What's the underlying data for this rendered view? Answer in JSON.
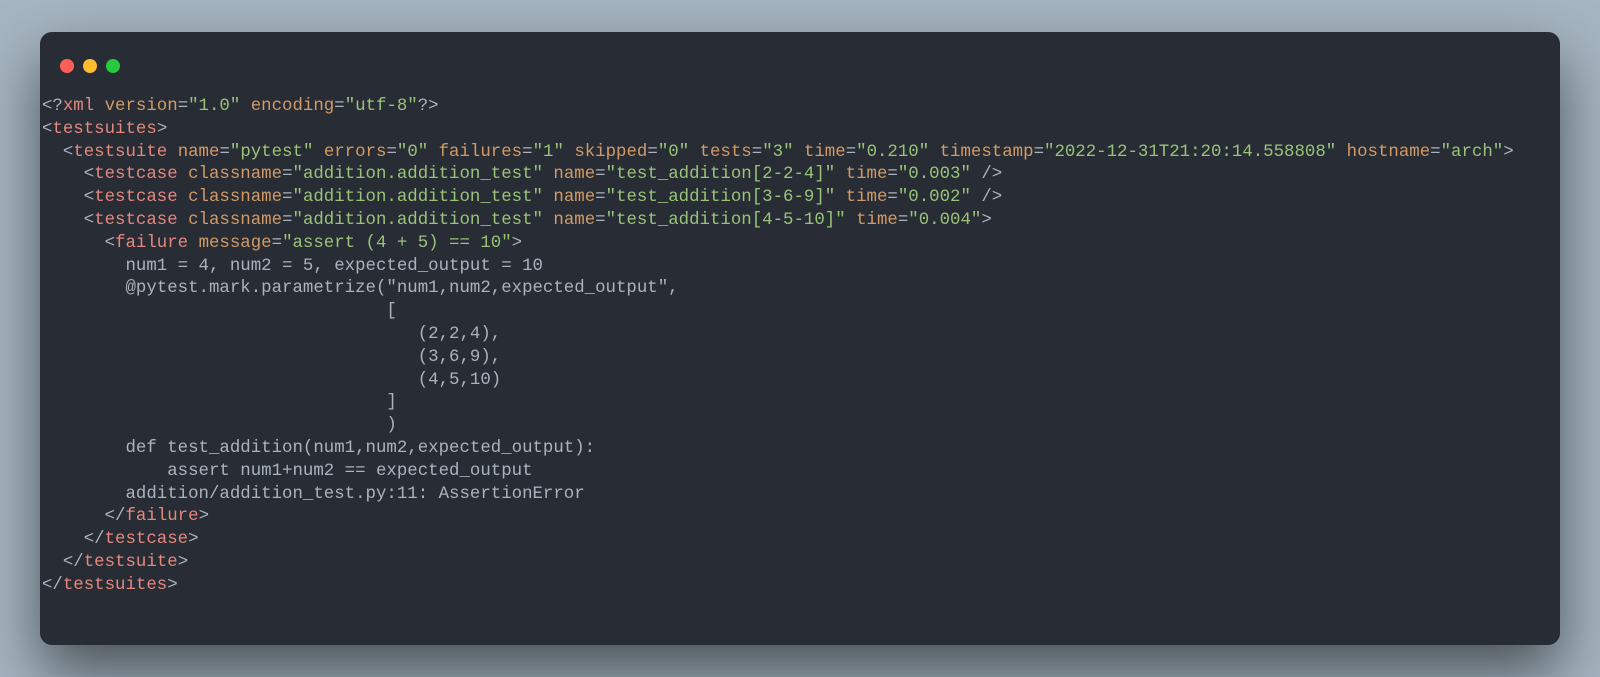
{
  "line1": "<?xml version=\"1.0\" encoding=\"utf-8\"?>",
  "line2_tag": "testsuites",
  "line3": {
    "tag": "testsuite",
    "attrs": {
      "name": "pytest",
      "errors": "0",
      "failures": "1",
      "skipped": "0",
      "tests": "3",
      "time": "0.210",
      "timestamp": "2022-12-31T21:20:14.558808",
      "hostname": "arch"
    }
  },
  "case1": {
    "tag": "testcase",
    "classname": "addition.addition_test",
    "name": "test_addition[2-2-4]",
    "time": "0.003"
  },
  "case2": {
    "tag": "testcase",
    "classname": "addition.addition_test",
    "name": "test_addition[3-6-9]",
    "time": "0.002"
  },
  "case3": {
    "tag": "testcase",
    "classname": "addition.addition_test",
    "name": "test_addition[4-5-10]",
    "time": "0.004"
  },
  "failure": {
    "tag": "failure",
    "message": "assert (4 + 5) == 10"
  },
  "body": {
    "l1": "      num1 = 4, num2 = 5, expected_output = 10",
    "l2": "      @pytest.mark.parametrize(\"num1,num2,expected_output\",",
    "l3": "                               [",
    "l4": "                                  (2,2,4),",
    "l5": "                                  (3,6,9),",
    "l6": "                                  (4,5,10)",
    "l7": "                               ]",
    "l8": "                               )",
    "l9": "      def test_addition(num1,num2,expected_output):",
    "l10": "          assert num1+num2 == expected_output",
    "l11": "      addition/addition_test.py:11: AssertionError"
  },
  "close_failure": "failure",
  "close_testcase": "testcase",
  "close_testsuite": "testsuite",
  "close_testsuites": "testsuites",
  "literals": {
    "xml": "xml",
    "version": "version",
    "encoding": "encoding",
    "v10": "\"1.0\"",
    "utf8": "\"utf-8\"",
    "name": "name",
    "errors": "errors",
    "failures": "failures",
    "skipped": "skipped",
    "tests": "tests",
    "time": "time",
    "timestamp": "timestamp",
    "hostname": "hostname",
    "classname": "classname",
    "message": "message"
  }
}
